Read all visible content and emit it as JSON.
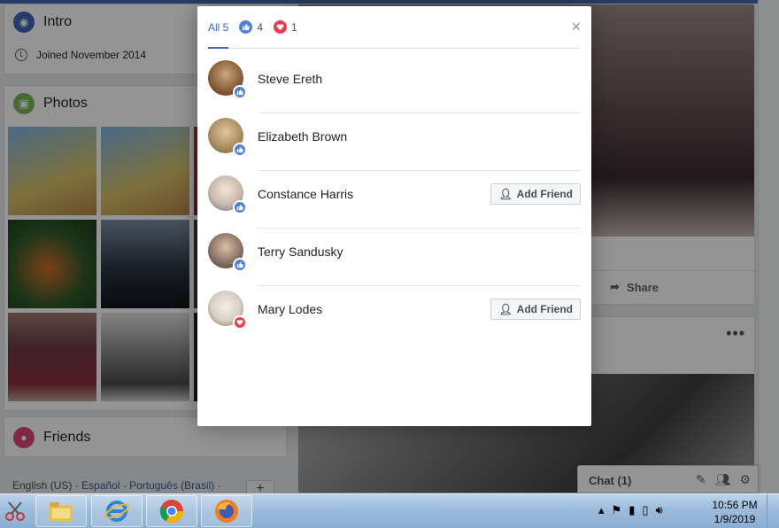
{
  "left": {
    "intro_title": "Intro",
    "joined": "Joined November 2014",
    "photos_title": "Photos",
    "friends_title": "Friends",
    "languages": [
      "English (US)",
      "Español",
      "Português (Brasil)"
    ],
    "lang_sep": "·",
    "add_label": "+"
  },
  "post": {
    "share_label": "Share",
    "more_label": "•••"
  },
  "chat": {
    "label": "Chat (1)"
  },
  "reactions": {
    "tabs": [
      {
        "label": "All 5",
        "icon": "none"
      },
      {
        "label": "4",
        "icon": "like-icon"
      },
      {
        "label": "1",
        "icon": "love-icon"
      }
    ],
    "close_label": "×",
    "people": [
      {
        "name": "Steve Ereth",
        "reaction": "like",
        "add_friend": false,
        "avatar_color": "#7a4e2c"
      },
      {
        "name": "Elizabeth Brown",
        "reaction": "like",
        "add_friend": false,
        "avatar_color": "#a48a5c"
      },
      {
        "name": "Constance Harris",
        "reaction": "like",
        "add_friend": true,
        "avatar_color": "#c9b9b0"
      },
      {
        "name": "Terry Sandusky",
        "reaction": "like",
        "add_friend": false,
        "avatar_color": "#8b7466"
      },
      {
        "name": "Mary Lodes",
        "reaction": "love",
        "add_friend": true,
        "avatar_color": "#d8cfc4"
      }
    ],
    "add_friend_label": "Add Friend"
  },
  "taskbar": {
    "time": "10:56 PM",
    "date": "1/9/2019"
  },
  "colors": {
    "like": "#4c7ee8",
    "love": "#f0384e",
    "fb_blue": "#4267b2"
  }
}
